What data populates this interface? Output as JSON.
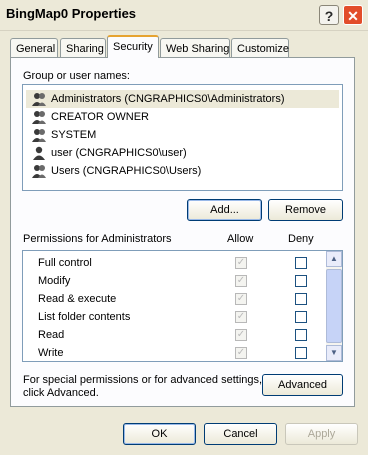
{
  "window": {
    "title": "BingMap0 Properties",
    "help_label": "?",
    "close_label": "✕"
  },
  "tabs": [
    {
      "label": "General"
    },
    {
      "label": "Sharing"
    },
    {
      "label": "Security"
    },
    {
      "label": "Web Sharing"
    },
    {
      "label": "Customize"
    }
  ],
  "groups": {
    "label": "Group or user names:",
    "items": [
      {
        "name": "Administrators (CNGRAPHICS0\\Administrators)",
        "selected": true,
        "icon": "group-icon"
      },
      {
        "name": "CREATOR OWNER",
        "icon": "group-icon"
      },
      {
        "name": "SYSTEM",
        "icon": "group-icon"
      },
      {
        "name": "user (CNGRAPHICS0\\user)",
        "icon": "user-icon"
      },
      {
        "name": "Users (CNGRAPHICS0\\Users)",
        "icon": "group-icon"
      }
    ],
    "add_label": "Add...",
    "remove_label": "Remove"
  },
  "permissions": {
    "label": "Permissions for Administrators",
    "allow_header": "Allow",
    "deny_header": "Deny",
    "rows": [
      {
        "name": "Full control",
        "allow": true,
        "deny": false
      },
      {
        "name": "Modify",
        "allow": true,
        "deny": false
      },
      {
        "name": "Read & execute",
        "allow": true,
        "deny": false
      },
      {
        "name": "List folder contents",
        "allow": true,
        "deny": false
      },
      {
        "name": "Read",
        "allow": true,
        "deny": false
      },
      {
        "name": "Write",
        "allow": true,
        "deny": false
      }
    ]
  },
  "advanced": {
    "text_line1": "For special permissions or for advanced settings,",
    "text_line2": "click Advanced.",
    "button_label": "Advanced"
  },
  "footer": {
    "ok_label": "OK",
    "cancel_label": "Cancel",
    "apply_label": "Apply"
  },
  "colors": {
    "accent": "#e6a331",
    "close": "#e24d2a",
    "border": "#7f9db9"
  }
}
